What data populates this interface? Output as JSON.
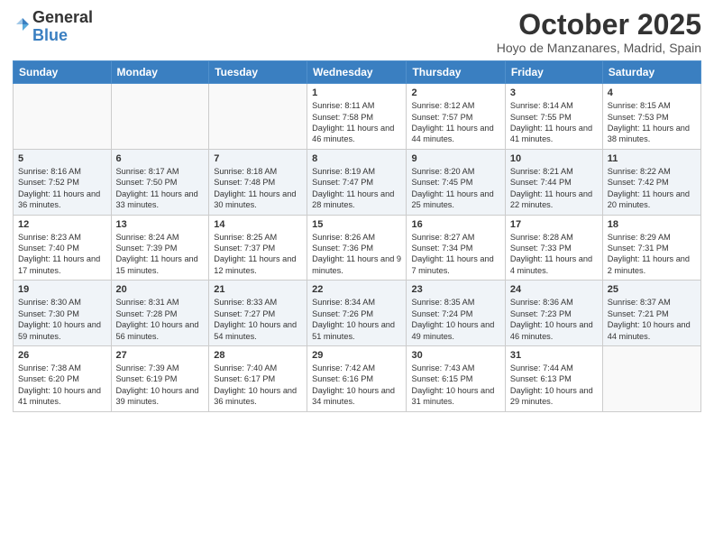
{
  "header": {
    "logo_general": "General",
    "logo_blue": "Blue",
    "month_title": "October 2025",
    "location": "Hoyo de Manzanares, Madrid, Spain"
  },
  "days_of_week": [
    "Sunday",
    "Monday",
    "Tuesday",
    "Wednesday",
    "Thursday",
    "Friday",
    "Saturday"
  ],
  "weeks": [
    [
      {
        "day": "",
        "content": ""
      },
      {
        "day": "",
        "content": ""
      },
      {
        "day": "",
        "content": ""
      },
      {
        "day": "1",
        "content": "Sunrise: 8:11 AM\nSunset: 7:58 PM\nDaylight: 11 hours and 46 minutes."
      },
      {
        "day": "2",
        "content": "Sunrise: 8:12 AM\nSunset: 7:57 PM\nDaylight: 11 hours and 44 minutes."
      },
      {
        "day": "3",
        "content": "Sunrise: 8:14 AM\nSunset: 7:55 PM\nDaylight: 11 hours and 41 minutes."
      },
      {
        "day": "4",
        "content": "Sunrise: 8:15 AM\nSunset: 7:53 PM\nDaylight: 11 hours and 38 minutes."
      }
    ],
    [
      {
        "day": "5",
        "content": "Sunrise: 8:16 AM\nSunset: 7:52 PM\nDaylight: 11 hours and 36 minutes."
      },
      {
        "day": "6",
        "content": "Sunrise: 8:17 AM\nSunset: 7:50 PM\nDaylight: 11 hours and 33 minutes."
      },
      {
        "day": "7",
        "content": "Sunrise: 8:18 AM\nSunset: 7:48 PM\nDaylight: 11 hours and 30 minutes."
      },
      {
        "day": "8",
        "content": "Sunrise: 8:19 AM\nSunset: 7:47 PM\nDaylight: 11 hours and 28 minutes."
      },
      {
        "day": "9",
        "content": "Sunrise: 8:20 AM\nSunset: 7:45 PM\nDaylight: 11 hours and 25 minutes."
      },
      {
        "day": "10",
        "content": "Sunrise: 8:21 AM\nSunset: 7:44 PM\nDaylight: 11 hours and 22 minutes."
      },
      {
        "day": "11",
        "content": "Sunrise: 8:22 AM\nSunset: 7:42 PM\nDaylight: 11 hours and 20 minutes."
      }
    ],
    [
      {
        "day": "12",
        "content": "Sunrise: 8:23 AM\nSunset: 7:40 PM\nDaylight: 11 hours and 17 minutes."
      },
      {
        "day": "13",
        "content": "Sunrise: 8:24 AM\nSunset: 7:39 PM\nDaylight: 11 hours and 15 minutes."
      },
      {
        "day": "14",
        "content": "Sunrise: 8:25 AM\nSunset: 7:37 PM\nDaylight: 11 hours and 12 minutes."
      },
      {
        "day": "15",
        "content": "Sunrise: 8:26 AM\nSunset: 7:36 PM\nDaylight: 11 hours and 9 minutes."
      },
      {
        "day": "16",
        "content": "Sunrise: 8:27 AM\nSunset: 7:34 PM\nDaylight: 11 hours and 7 minutes."
      },
      {
        "day": "17",
        "content": "Sunrise: 8:28 AM\nSunset: 7:33 PM\nDaylight: 11 hours and 4 minutes."
      },
      {
        "day": "18",
        "content": "Sunrise: 8:29 AM\nSunset: 7:31 PM\nDaylight: 11 hours and 2 minutes."
      }
    ],
    [
      {
        "day": "19",
        "content": "Sunrise: 8:30 AM\nSunset: 7:30 PM\nDaylight: 10 hours and 59 minutes."
      },
      {
        "day": "20",
        "content": "Sunrise: 8:31 AM\nSunset: 7:28 PM\nDaylight: 10 hours and 56 minutes."
      },
      {
        "day": "21",
        "content": "Sunrise: 8:33 AM\nSunset: 7:27 PM\nDaylight: 10 hours and 54 minutes."
      },
      {
        "day": "22",
        "content": "Sunrise: 8:34 AM\nSunset: 7:26 PM\nDaylight: 10 hours and 51 minutes."
      },
      {
        "day": "23",
        "content": "Sunrise: 8:35 AM\nSunset: 7:24 PM\nDaylight: 10 hours and 49 minutes."
      },
      {
        "day": "24",
        "content": "Sunrise: 8:36 AM\nSunset: 7:23 PM\nDaylight: 10 hours and 46 minutes."
      },
      {
        "day": "25",
        "content": "Sunrise: 8:37 AM\nSunset: 7:21 PM\nDaylight: 10 hours and 44 minutes."
      }
    ],
    [
      {
        "day": "26",
        "content": "Sunrise: 7:38 AM\nSunset: 6:20 PM\nDaylight: 10 hours and 41 minutes."
      },
      {
        "day": "27",
        "content": "Sunrise: 7:39 AM\nSunset: 6:19 PM\nDaylight: 10 hours and 39 minutes."
      },
      {
        "day": "28",
        "content": "Sunrise: 7:40 AM\nSunset: 6:17 PM\nDaylight: 10 hours and 36 minutes."
      },
      {
        "day": "29",
        "content": "Sunrise: 7:42 AM\nSunset: 6:16 PM\nDaylight: 10 hours and 34 minutes."
      },
      {
        "day": "30",
        "content": "Sunrise: 7:43 AM\nSunset: 6:15 PM\nDaylight: 10 hours and 31 minutes."
      },
      {
        "day": "31",
        "content": "Sunrise: 7:44 AM\nSunset: 6:13 PM\nDaylight: 10 hours and 29 minutes."
      },
      {
        "day": "",
        "content": ""
      }
    ]
  ]
}
